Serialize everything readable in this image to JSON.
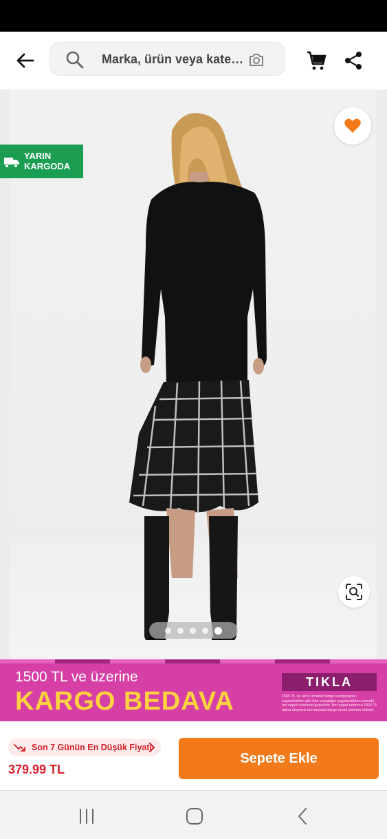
{
  "header": {
    "search_placeholder": "Marka, ürün veya kate…"
  },
  "product": {
    "cargo_badge": "YARIN KARGODA",
    "image_count": 5,
    "active_image": 5
  },
  "promo": {
    "line1": "1500 TL ve üzerine",
    "line2": "KARGO BEDAVA",
    "cta": "TIKLA",
    "fine_print": "1500 TL ve üzeri ücretsiz kargo kampanyası, kupon/indirim gibi tüm avantajlar uygulandıktan sonraki net sepet tutarında geçerlidir. Net sepet tutarının 1500 TL altına düşmesi durumunda kargo ücreti sisteme eklenir."
  },
  "purchase": {
    "lowest_price_label": "Son 7 Günün En Düşük Fiyatı",
    "price": "379.99 TL",
    "add_to_cart": "Sepete Ekle"
  },
  "colors": {
    "brand_orange": "#f27a1a",
    "price_red": "#d6202a",
    "cargo_green": "#1b9e52",
    "promo_pink": "#d63fa6",
    "promo_yellow": "#ffd23f"
  },
  "icons": [
    "back-arrow-icon",
    "search-icon",
    "camera-icon",
    "cart-icon",
    "share-icon",
    "heart-icon",
    "truck-icon",
    "visual-search-icon",
    "trend-down-icon",
    "chevron-right-icon",
    "recent-apps-icon",
    "home-icon",
    "back-nav-icon"
  ]
}
